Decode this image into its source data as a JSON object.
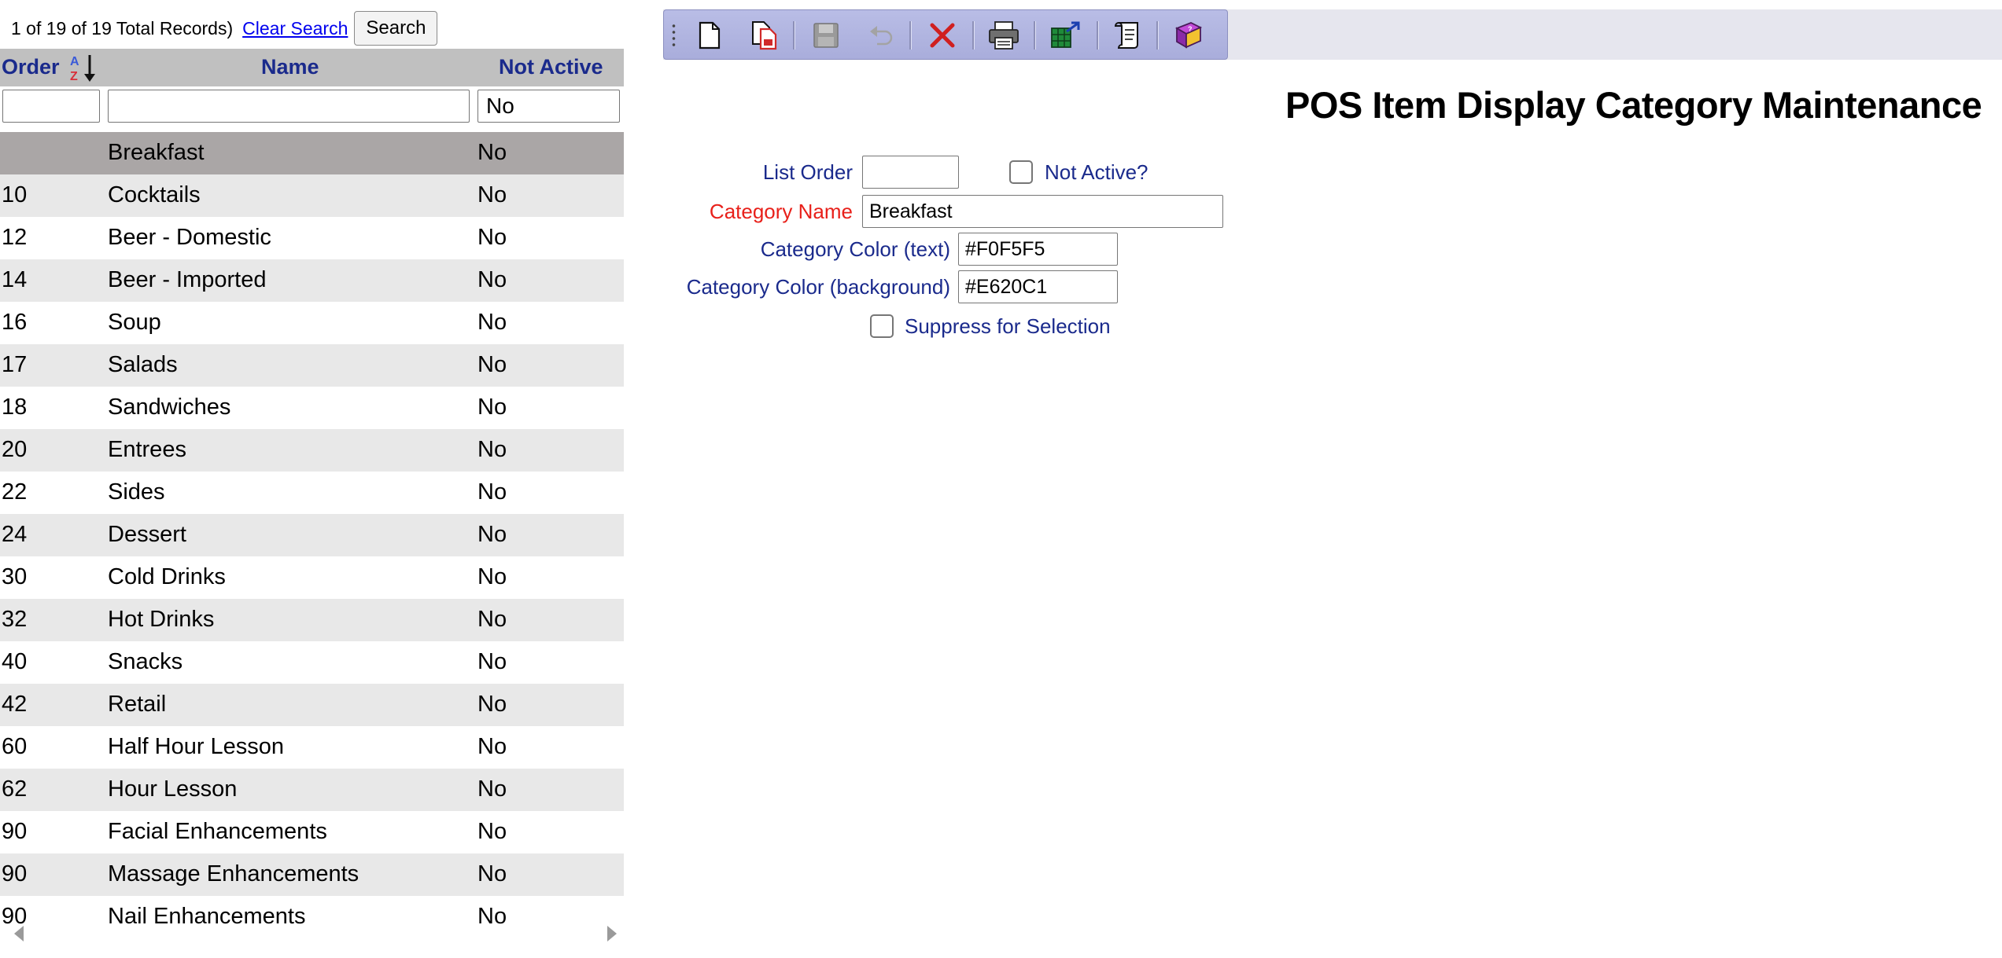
{
  "list": {
    "record_count": "1 of 19 of 19 Total Records)",
    "clear_search": "Clear Search",
    "search_button": "Search",
    "headers": {
      "order": "Order",
      "name": "Name",
      "not_active": "Not Active"
    },
    "filters": {
      "order": "",
      "name": "",
      "not_active": "No"
    },
    "rows": [
      {
        "order": "",
        "name": "Breakfast",
        "not_active": "No"
      },
      {
        "order": "10",
        "name": "Cocktails",
        "not_active": "No"
      },
      {
        "order": "12",
        "name": "Beer - Domestic",
        "not_active": "No"
      },
      {
        "order": "14",
        "name": "Beer - Imported",
        "not_active": "No"
      },
      {
        "order": "16",
        "name": "Soup",
        "not_active": "No"
      },
      {
        "order": "17",
        "name": "Salads",
        "not_active": "No"
      },
      {
        "order": "18",
        "name": "Sandwiches",
        "not_active": "No"
      },
      {
        "order": "20",
        "name": "Entrees",
        "not_active": "No"
      },
      {
        "order": "22",
        "name": "Sides",
        "not_active": "No"
      },
      {
        "order": "24",
        "name": "Dessert",
        "not_active": "No"
      },
      {
        "order": "30",
        "name": "Cold Drinks",
        "not_active": "No"
      },
      {
        "order": "32",
        "name": "Hot Drinks",
        "not_active": "No"
      },
      {
        "order": "40",
        "name": "Snacks",
        "not_active": "No"
      },
      {
        "order": "42",
        "name": "Retail",
        "not_active": "No"
      },
      {
        "order": "60",
        "name": "Half Hour Lesson",
        "not_active": "No"
      },
      {
        "order": "62",
        "name": "Hour Lesson",
        "not_active": "No"
      },
      {
        "order": "90",
        "name": "Facial Enhancements",
        "not_active": "No"
      },
      {
        "order": "90",
        "name": "Massage Enhancements",
        "not_active": "No"
      },
      {
        "order": "90",
        "name": "Nail Enhancements",
        "not_active": "No"
      }
    ],
    "selected_row": 0
  },
  "toolbar": {
    "buttons": [
      "new-document-icon",
      "copy-document-icon",
      "save-icon",
      "undo-icon",
      "delete-icon",
      "print-icon",
      "export-icon",
      "script-icon",
      "help-book-icon"
    ]
  },
  "detail": {
    "title": "POS Item Display Category Maintenance",
    "list_order_label": "List Order",
    "list_order_value": "",
    "not_active_label": "Not Active?",
    "not_active_checked": false,
    "category_name_label": "Category Name",
    "category_name_value": "Breakfast",
    "color_text_label": "Category Color (text)",
    "color_text_value": "#F0F5F5",
    "color_background_label": "Category Color (background)",
    "color_background_value": "#E620C1",
    "suppress_label": "Suppress for Selection",
    "suppress_checked": false
  },
  "colors": {
    "header_text": "#1a2a8c",
    "required_label": "#e8201a",
    "selected_row": "#aaa6a6",
    "alt_row": "#e8e8e8",
    "toolbar": "#b9bde6"
  }
}
